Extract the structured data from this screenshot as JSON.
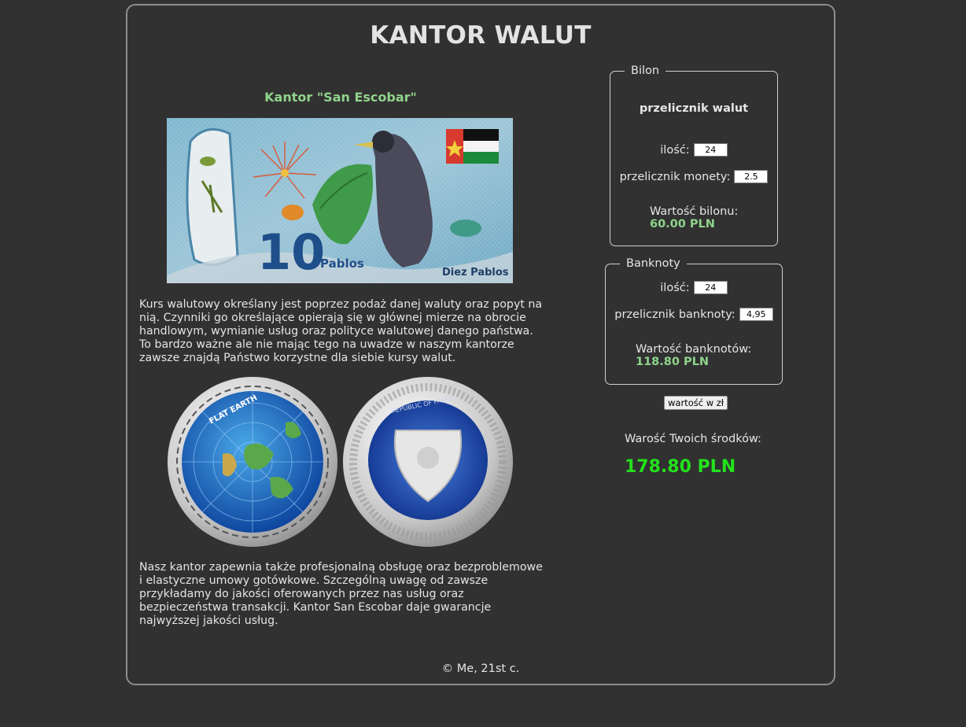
{
  "page": {
    "title": "KANTOR WALUT",
    "subtitle": "Kantor \"San Escobar\"",
    "footer": "© Me, 21st c."
  },
  "content": {
    "paragraph_1": "Kurs walutowy określany jest poprzez podaż danej waluty oraz popyt na nią. Czynniki go określające opierają się w głównej mierze na obrocie handlowym, wymianie usług oraz polityce walutowej danego państwa. To bardzo ważne ale nie mając tego na uwadze w naszym kantorze zawsze znajdą Państwo korzystne dla siebie kursy walut.",
    "paragraph_2": "Nasz kantor zapewnia także profesjonalną obsługę oraz bezproblemowe i elastyczne umowy gotówkowe. Szczególną uwagę od zawsze przykładamy do jakości oferowanych przez nas usług oraz bezpieczeństwa transakcji. Kantor San Escobar daje gwarancje najwyższej jakości usług.",
    "banknote": {
      "number": "10",
      "word": "Pablos",
      "caption": "Diez Pablos"
    },
    "coin_left_text": "FLAT EARTH",
    "coin_right_text": "REPUBLIC OF PALAU"
  },
  "bilon": {
    "legend": "Bilon",
    "heading": "przelicznik walut",
    "quantity_label": "ilość:",
    "quantity_value": "24",
    "rate_label": "przelicznik monety:",
    "rate_value": "2.5",
    "result_label": "Wartość bilonu:",
    "result_value": "60.00 PLN"
  },
  "banknoty": {
    "legend": "Banknoty",
    "quantity_label": "ilość:",
    "quantity_value": "24",
    "rate_label": "przelicznik banknoty:",
    "rate_value": "4,95",
    "result_label": "Wartość banknotów:",
    "result_value": "118.80 PLN"
  },
  "actions": {
    "calculate_label": "wartość w zł"
  },
  "total": {
    "label": "Warość Twoich środków:",
    "value": "178.80 PLN"
  },
  "colors": {
    "background": "#313131",
    "accent_green": "#8fd38b",
    "total_green": "#22e31b"
  }
}
